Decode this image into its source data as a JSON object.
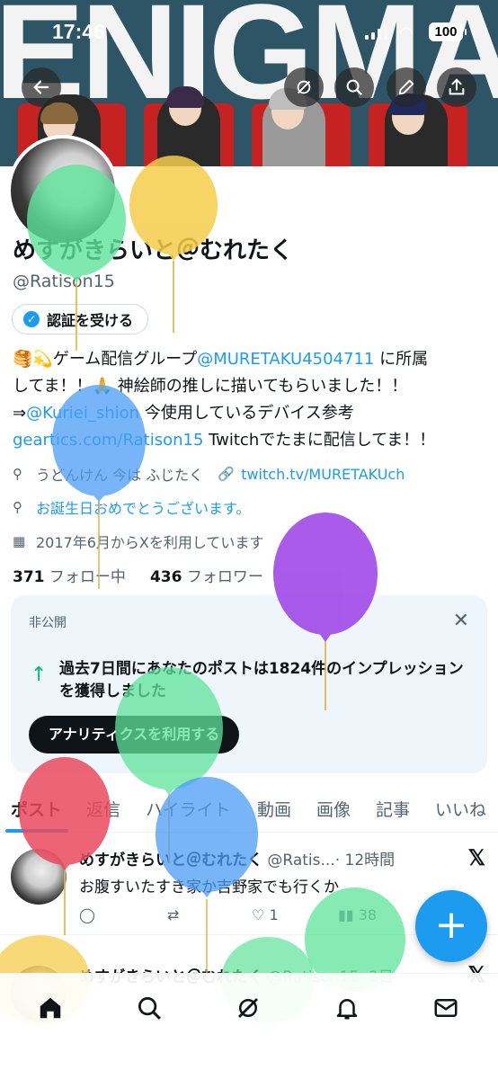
{
  "status": {
    "time": "17:46",
    "battery": "100"
  },
  "header": {
    "banner_text": "ENIGMA"
  },
  "profile": {
    "name": "めすがきらいと＠むれたく",
    "handle": "@Ratison15",
    "verify_label": "認証を受ける",
    "bio_line1_pre": "🥞💫ゲーム配信グループ",
    "bio_mention1": "@MURETAKU4504711",
    "bio_line1_post": " に所属",
    "bio_line2": "してま！！🙏 神絵師の推しに描いてもらいました！！",
    "bio_line3_pre": "⇒",
    "bio_mention2": "@Kuriei_shion",
    "bio_line3_post": " 今使用しているデバイス参考",
    "bio_link": "geartics.com/Ratison15",
    "bio_line4_post": " Twitchでたまに配信してま！！",
    "location": "うどんけん 今は ふじたく",
    "website": "twitch.tv/MURETAKUch",
    "birthday": "お誕生日おめでとうございます。",
    "joined": "2017年6月からXを利用しています",
    "following_count": "371",
    "following_label": "フォロー中",
    "followers_count": "436",
    "followers_label": "フォロワー"
  },
  "card": {
    "private_label": "非公開",
    "impressions": "過去7日間にあなたのポストは1824件のインプレッションを獲得しました",
    "button": "アナリティクスを利用する"
  },
  "tabs": [
    "ポスト",
    "返信",
    "ハイライト",
    "動画",
    "画像",
    "記事",
    "いいね"
  ],
  "posts": [
    {
      "name": "めすがきらいと＠むれたく",
      "handle": " @Ratis...",
      "time": "· 12時間",
      "text": "お腹すいたすき家か吉野家でも行くか",
      "likes": "1",
      "views": "38"
    },
    {
      "name": "めすがきらいと＠むれたく",
      "handle": " @Ratison15",
      "time": "· 2日",
      "text": "",
      "likes": "",
      "views": ""
    }
  ],
  "fab_label": "+",
  "colors": {
    "accent": "#1d9bf0",
    "banner": "#2e5565",
    "card": "#eef6fc"
  }
}
